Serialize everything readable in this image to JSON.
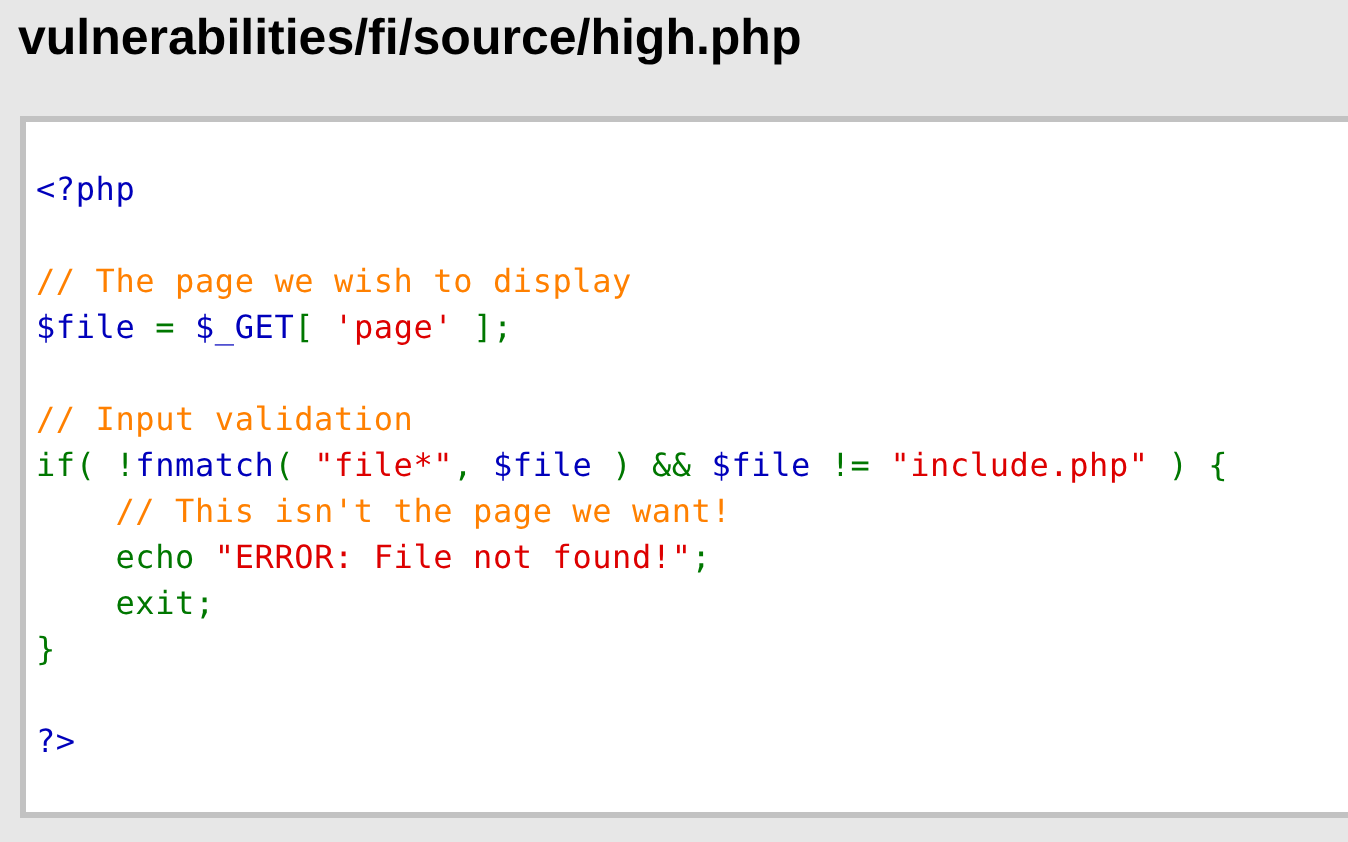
{
  "title": "vulnerabilities/fi/source/high.php",
  "code_lines": [
    {
      "kind": "code",
      "tokens": [
        {
          "kind": "default",
          "text": "<?php"
        }
      ]
    },
    {
      "kind": "blank"
    },
    {
      "kind": "code",
      "tokens": [
        {
          "kind": "comment",
          "text": "// The page we wish to display"
        }
      ]
    },
    {
      "kind": "code",
      "tokens": [
        {
          "kind": "default",
          "text": "$file "
        },
        {
          "kind": "keyword",
          "text": "= "
        },
        {
          "kind": "default",
          "text": "$_GET"
        },
        {
          "kind": "keyword",
          "text": "[ "
        },
        {
          "kind": "string",
          "text": "'page' "
        },
        {
          "kind": "keyword",
          "text": "];"
        }
      ]
    },
    {
      "kind": "blank"
    },
    {
      "kind": "code",
      "tokens": [
        {
          "kind": "comment",
          "text": "// Input validation"
        }
      ]
    },
    {
      "kind": "code",
      "tokens": [
        {
          "kind": "keyword",
          "text": "if( !"
        },
        {
          "kind": "default",
          "text": "fnmatch"
        },
        {
          "kind": "keyword",
          "text": "( "
        },
        {
          "kind": "string",
          "text": "\"file*\""
        },
        {
          "kind": "keyword",
          "text": ", "
        },
        {
          "kind": "default",
          "text": "$file "
        },
        {
          "kind": "keyword",
          "text": ") && "
        },
        {
          "kind": "default",
          "text": "$file "
        },
        {
          "kind": "keyword",
          "text": "!= "
        },
        {
          "kind": "string",
          "text": "\"include.php\" "
        },
        {
          "kind": "keyword",
          "text": ") {"
        }
      ]
    },
    {
      "kind": "code",
      "tokens": [
        {
          "kind": "comment",
          "text": "    // This isn't the page we want!"
        }
      ]
    },
    {
      "kind": "code",
      "tokens": [
        {
          "kind": "keyword",
          "text": "    echo "
        },
        {
          "kind": "string",
          "text": "\"ERROR: File not found!\""
        },
        {
          "kind": "keyword",
          "text": ";"
        }
      ]
    },
    {
      "kind": "code",
      "tokens": [
        {
          "kind": "keyword",
          "text": "    exit;"
        }
      ]
    },
    {
      "kind": "code",
      "tokens": [
        {
          "kind": "keyword",
          "text": "}"
        }
      ]
    },
    {
      "kind": "blank"
    },
    {
      "kind": "code",
      "tokens": [
        {
          "kind": "default",
          "text": "?>"
        }
      ]
    }
  ]
}
